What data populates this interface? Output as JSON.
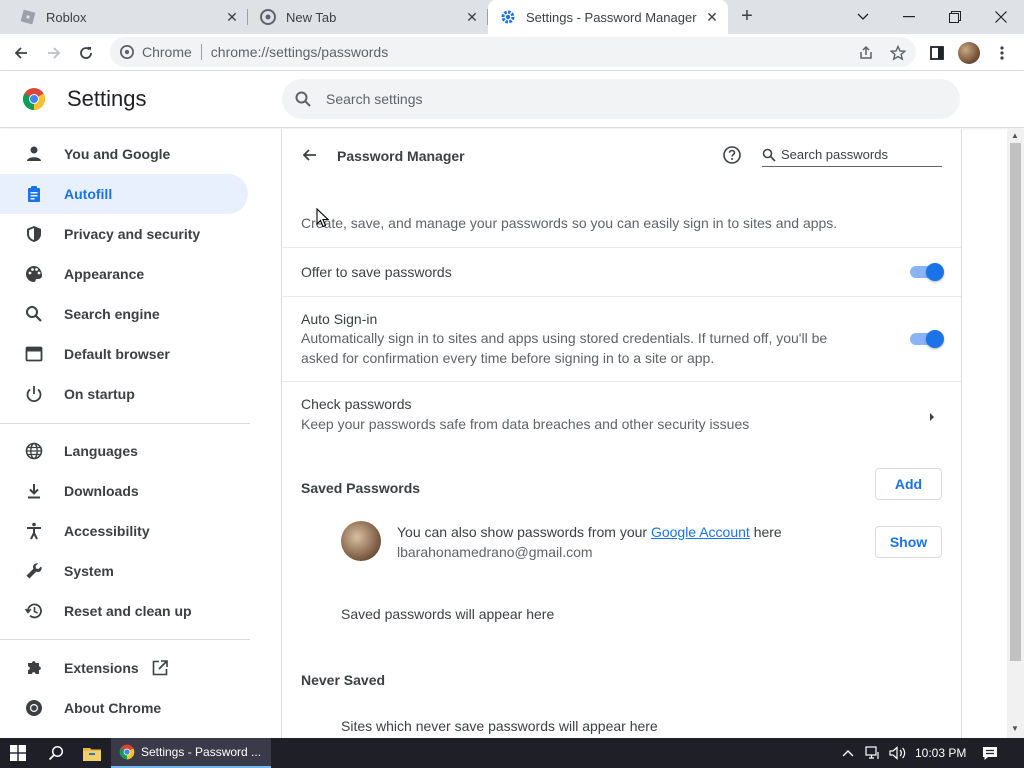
{
  "tabs": [
    {
      "title": "Roblox",
      "icon": "roblox-favicon-icon",
      "active": false
    },
    {
      "title": "New Tab",
      "icon": "chrome-favicon-icon",
      "active": false
    },
    {
      "title": "Settings - Password Manager",
      "icon": "settings-gear-icon",
      "active": true
    }
  ],
  "toolbar": {
    "site_label": "Chrome",
    "url": "chrome://settings/passwords"
  },
  "header": {
    "title": "Settings",
    "search_placeholder": "Search settings"
  },
  "sidebar": {
    "items": [
      {
        "label": "You and Google",
        "icon": "person-icon",
        "active": false
      },
      {
        "label": "Autofill",
        "icon": "clipboard-icon",
        "active": true
      },
      {
        "label": "Privacy and security",
        "icon": "shield-icon",
        "active": false
      },
      {
        "label": "Appearance",
        "icon": "palette-icon",
        "active": false
      },
      {
        "label": "Search engine",
        "icon": "search-icon",
        "active": false
      },
      {
        "label": "Default browser",
        "icon": "browser-window-icon",
        "active": false
      },
      {
        "label": "On startup",
        "icon": "power-icon",
        "active": false
      },
      {
        "label": "Languages",
        "icon": "globe-icon",
        "active": false
      },
      {
        "label": "Downloads",
        "icon": "download-icon",
        "active": false
      },
      {
        "label": "Accessibility",
        "icon": "accessibility-icon",
        "active": false
      },
      {
        "label": "System",
        "icon": "wrench-icon",
        "active": false
      },
      {
        "label": "Reset and clean up",
        "icon": "history-icon",
        "active": false
      },
      {
        "label": "Extensions",
        "icon": "puzzle-icon",
        "active": false
      },
      {
        "label": "About Chrome",
        "icon": "chrome-icon",
        "active": false
      }
    ]
  },
  "password_manager": {
    "title": "Password Manager",
    "search_placeholder": "Search passwords",
    "description": "Create, save, and manage your passwords so you can easily sign in to sites and apps.",
    "offer_to_save": {
      "label": "Offer to save passwords",
      "enabled": true
    },
    "auto_signin": {
      "label": "Auto Sign-in",
      "description": "Automatically sign in to sites and apps using stored credentials. If turned off, you'll be asked for confirmation every time before signing in to a site or app.",
      "enabled": true
    },
    "check_passwords": {
      "label": "Check passwords",
      "description": "Keep your passwords safe from data breaches and other security issues"
    },
    "saved_passwords": {
      "heading": "Saved Passwords",
      "add_label": "Add",
      "account_text_prefix": "You can also show passwords from your ",
      "account_link": "Google Account",
      "account_text_suffix": " here",
      "email": "lbarahonamedrano@gmail.com",
      "show_label": "Show",
      "empty_text": "Saved passwords will appear here"
    },
    "never_saved": {
      "heading": "Never Saved",
      "empty_text": "Sites which never save passwords will appear here"
    }
  },
  "taskbar": {
    "app_label": "Settings - Password ...",
    "time": "10:03 PM"
  },
  "colors": {
    "accent": "#1a73e8",
    "active_nav_bg": "#e8f0fe",
    "taskbar": "#1f1f28"
  }
}
